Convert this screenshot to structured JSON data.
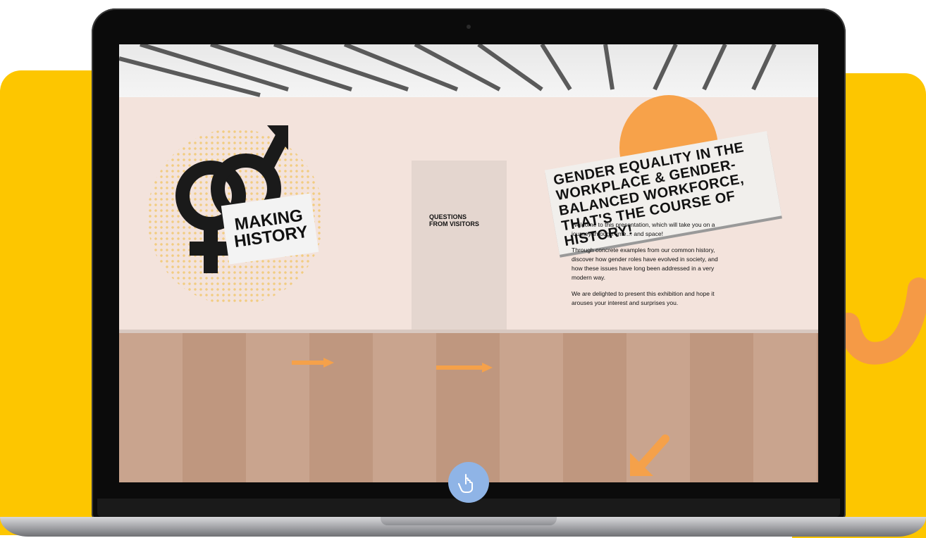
{
  "scene": {
    "poster_title": "GENDER EQUALITY IN THE WORKPLACE & GENDER-BALANCED WORKFORCE, THAT'S THE COURSE OF HISTORY!",
    "left_sign": "MAKING HISTORY",
    "inner_sign": "QUESTIONS FROM VISITORS",
    "welcome_paragraphs": [
      "Welcome to this presentation, which will take you on a journey through time… and space!",
      "Through concrete examples from our common history, discover how gender roles have evolved in society, and how these issues have long been addressed in a very modern way.",
      "We are delighted to present this exhibition and hope it arouses your interest and surprises you."
    ]
  },
  "icons": {
    "gender_symbol": "gender-symbol-icon",
    "hand_pointer": "hand-pointer-icon"
  },
  "colors": {
    "yellow": "#fdc600",
    "orange": "#f7a24a",
    "pointer_blue": "#8fb4e6"
  }
}
